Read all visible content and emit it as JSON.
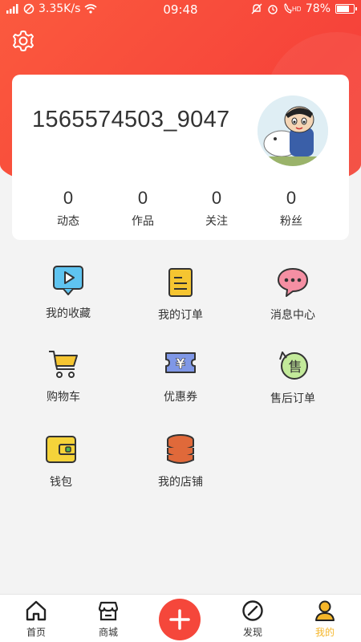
{
  "status_bar": {
    "signal_text": "⁴⁶ıll",
    "speed": "3.35K/s",
    "time": "09:48",
    "volte": "HD",
    "battery": "78%",
    "battery_level": 0.78
  },
  "profile": {
    "username": "1565574503_9047",
    "stats": [
      {
        "value": "0",
        "label": "动态"
      },
      {
        "value": "0",
        "label": "作品"
      },
      {
        "value": "0",
        "label": "关注"
      },
      {
        "value": "0",
        "label": "粉丝"
      }
    ]
  },
  "menu": {
    "items": [
      {
        "label": "我的收藏",
        "icon": "video-favorite-icon"
      },
      {
        "label": "我的订单",
        "icon": "order-document-icon"
      },
      {
        "label": "消息中心",
        "icon": "message-bubble-icon"
      },
      {
        "label": "购物车",
        "icon": "shopping-cart-icon"
      },
      {
        "label": "优惠券",
        "icon": "coupon-icon"
      },
      {
        "label": "售后订单",
        "icon": "after-sale-icon"
      },
      {
        "label": "钱包",
        "icon": "wallet-icon"
      },
      {
        "label": "我的店铺",
        "icon": "shop-stack-icon"
      }
    ],
    "coupon_symbol": "¥",
    "after_sale_symbol": "售"
  },
  "tabbar": {
    "tabs": [
      {
        "label": "首页",
        "icon": "home-icon"
      },
      {
        "label": "商城",
        "icon": "store-icon"
      },
      {
        "label": "发现",
        "icon": "compass-icon"
      },
      {
        "label": "我的",
        "icon": "profile-icon",
        "active": true
      }
    ],
    "add_icon": "plus-icon"
  },
  "colors": {
    "brand_red": "#f5473b",
    "active_tab": "#f5b62a"
  }
}
